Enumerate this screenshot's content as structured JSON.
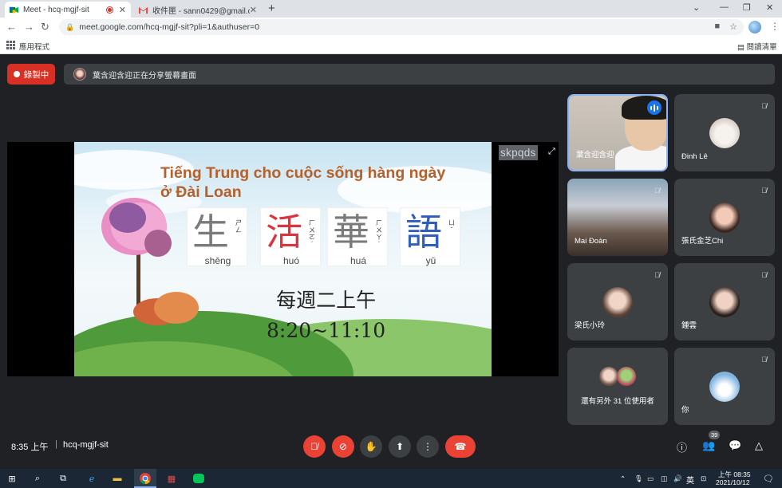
{
  "browser": {
    "tabs": [
      {
        "title": "Meet - hcq-mgjf-sit",
        "active": true
      },
      {
        "title": "收件匣 - sann0429@gmail.com",
        "active": false
      }
    ],
    "new_tab_symbol": "+",
    "url": "meet.google.com/hcq-mgjf-sit?pli=1&authuser=0",
    "bookmarks_apps_label": "應用程式",
    "reading_list_label": "閱讀清單"
  },
  "meet": {
    "recording_label": "錄製中",
    "presenting_banner": "葉含迎含迎正在分享螢幕畫面",
    "time": "8:35 上午",
    "separator": "|",
    "meeting_code": "hcq-mgjf-sit",
    "participant_count": "39",
    "overlay_label": "skpqds"
  },
  "slide": {
    "title_line1": "Tiếng Trung cho cuộc sống hàng ngày",
    "title_line2": "ở Đài Loan",
    "characters": [
      {
        "han": "生",
        "pinyin": "shēng",
        "zhuyin": "ㄕㄥ",
        "color": "#7a7a7a"
      },
      {
        "han": "活",
        "pinyin": "huó",
        "zhuyin": "ㄏㄨㄛˊ",
        "color": "#d9353f"
      },
      {
        "han": "華",
        "pinyin": "huá",
        "zhuyin": "ㄏㄨㄚˊ",
        "color": "#7a7a7a"
      },
      {
        "han": "語",
        "pinyin": "yǔ",
        "zhuyin": "ㄩˇ",
        "color": "#2f5fb8"
      }
    ],
    "schedule_line1": "每週二上午",
    "schedule_line2": "8:20~11:10"
  },
  "participants": [
    {
      "name": "葉含迎含迎",
      "type": "video-person",
      "speaking": true
    },
    {
      "name": "Đinh Lê",
      "type": "avatar",
      "avatar_color": "#e9e4df"
    },
    {
      "name": "Mai Đoàn",
      "type": "video-room"
    },
    {
      "name": "張氏金芝Chi",
      "type": "avatar",
      "avatar_color": "#e8b5b0"
    },
    {
      "name": "梁氏小玲",
      "type": "avatar",
      "avatar_color": "#d9c2b8"
    },
    {
      "name": "鍾雲",
      "type": "avatar",
      "avatar_color": "#c9b1a8"
    },
    {
      "name": "還有另外 31 位使用者",
      "type": "more"
    },
    {
      "name": "你",
      "type": "avatar",
      "avatar_color": "#7fb3e0"
    }
  ],
  "taskbar": {
    "time": "上午 08:35",
    "date": "2021/10/12",
    "ime": "英"
  },
  "colors": {
    "meet_bg": "#202124",
    "tile_bg": "#3c4043",
    "red": "#ea4335",
    "accent_blue": "#8ab4f8",
    "slide_title": "#b6602a"
  }
}
